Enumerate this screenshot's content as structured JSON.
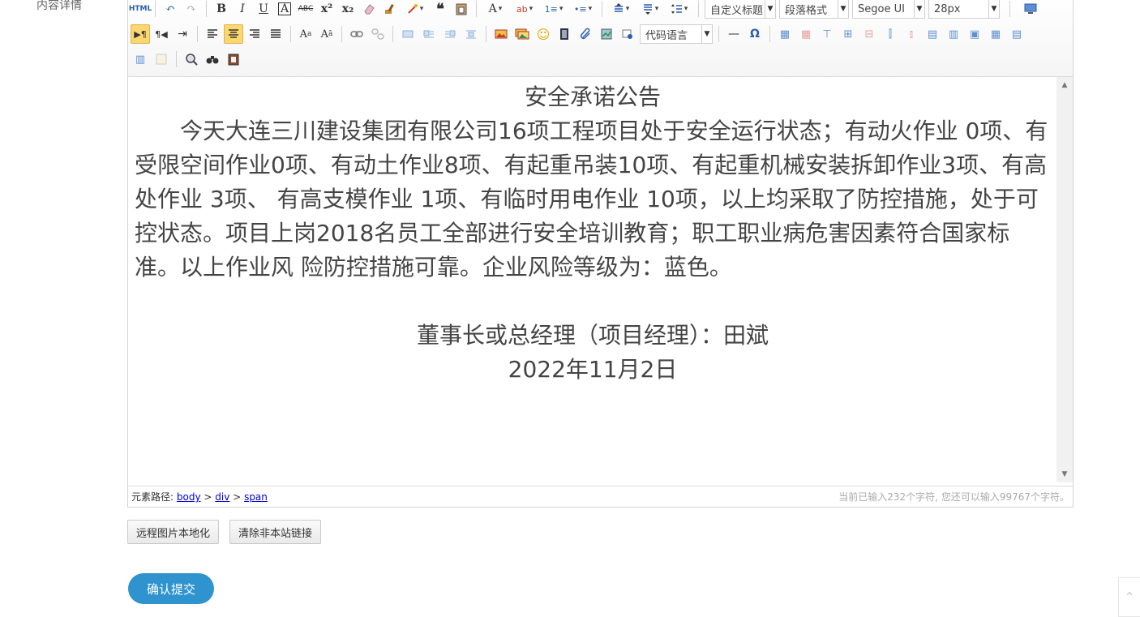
{
  "form": {
    "field_label": "内容详情",
    "buttons": {
      "localize_images": "远程图片本地化",
      "clear_external_links": "清除非本站链接",
      "submit": "确认提交"
    }
  },
  "toolbar": {
    "html_label": "HTML",
    "icons": {
      "undo": "↶",
      "redo": "↷",
      "bold": "B",
      "italic": "I",
      "underline": "U",
      "border": "A",
      "strikethrough": "ABC",
      "superscript": "x²",
      "subscript": "x₂",
      "quote": "❝",
      "font_color": "A",
      "highlight": "ab",
      "ordered_list": "1≡",
      "unordered_list": "•≡",
      "ltr": "▶¶",
      "rtl": "¶◀",
      "indent": "⇥",
      "hr": "—",
      "omega": "Ω"
    },
    "combos": {
      "custom_heading": "自定义标题",
      "paragraph_format": "段落格式",
      "font_family": "Segoe UI",
      "font_size": "28px",
      "code_language": "代码语言"
    }
  },
  "document": {
    "title": "安全承诺公告",
    "body": "今天大连三川建设集团有限公司16项工程项目处于安全运行状态；有动火作业 0项、有受限空间作业0项、有动土作业8项、有起重吊装10项、有起重机械安装拆卸作业3项、有高处作业 3项、 有高支模作业 1项、有临时用电作业 10项，以上均采取了防控措施，处于可控状态。项目上岗2018名员工全部进行安全培训教育；职工职业病危害因素符合国家标准。以上作业风 险防控措施可靠。企业风险等级为：蓝色。",
    "signature": "董事长或总经理（项目经理）：田斌",
    "date": "2022年11月2日"
  },
  "statusbar": {
    "path_label": "元素路径:",
    "path": [
      "body",
      "div",
      "span"
    ],
    "separator": ">",
    "char_count": "当前已输入232个字符, 您还可以输入99767个字符。"
  }
}
